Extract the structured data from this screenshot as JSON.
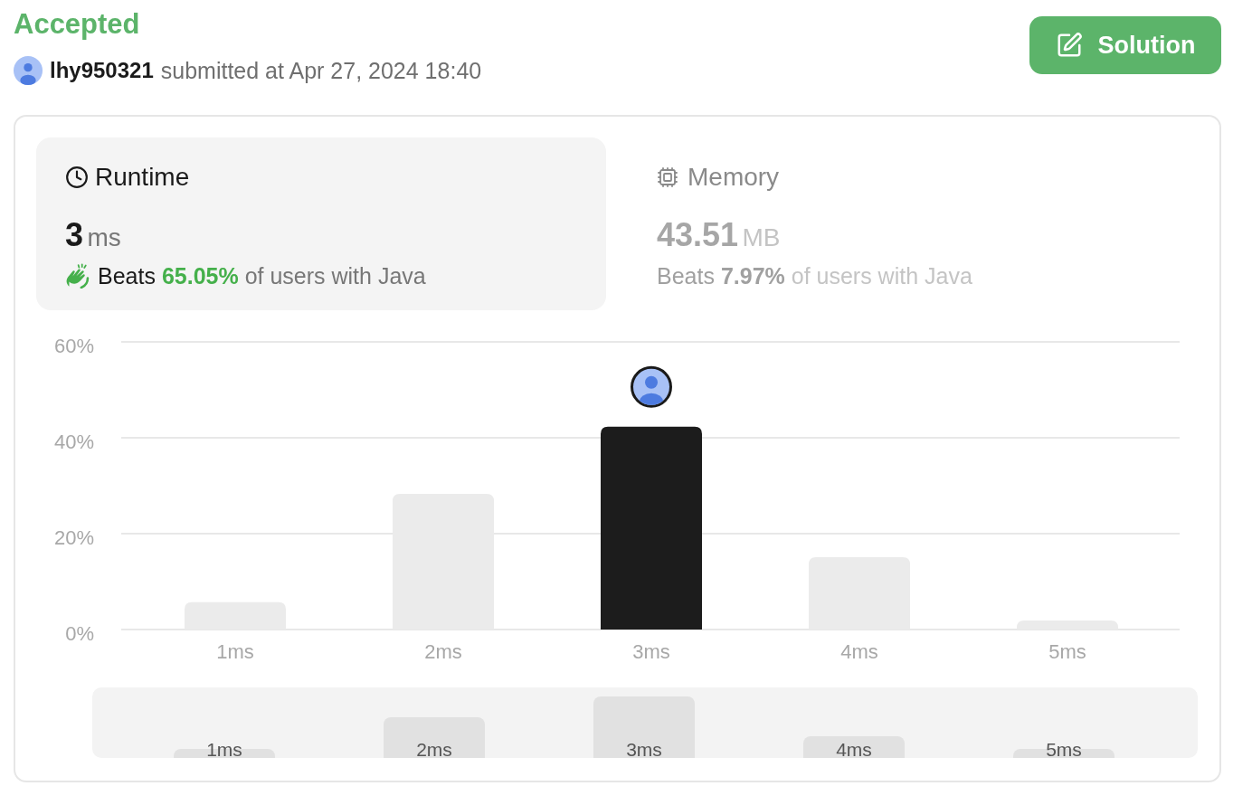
{
  "status": "Accepted",
  "submission": {
    "user": "lhy950321",
    "text": "submitted at Apr 27, 2024 18:40"
  },
  "solution_button": {
    "label": "Solution"
  },
  "stats": [
    {
      "kind": "runtime",
      "title": "Runtime",
      "value": "3",
      "unit": "ms",
      "beats_label": "Beats",
      "beats_value": "65.05%",
      "beats_suffix": "of users with Java",
      "selected": true
    },
    {
      "kind": "memory",
      "title": "Memory",
      "value": "43.51",
      "unit": "MB",
      "beats_label": "Beats",
      "beats_value": "7.97%",
      "beats_suffix": "of users with Java",
      "selected": false
    }
  ],
  "chart": {
    "chart_data": {
      "type": "bar",
      "categories": [
        "1ms",
        "2ms",
        "3ms",
        "4ms",
        "5ms"
      ],
      "values": [
        5.7,
        28.3,
        42.3,
        15.1,
        1.9
      ],
      "ylim": [
        0,
        60
      ],
      "yticks": [
        {
          "value": 0,
          "label": "0%"
        },
        {
          "value": 20,
          "label": "20%"
        },
        {
          "value": 40,
          "label": "40%"
        },
        {
          "value": 60,
          "label": "60%"
        }
      ]
    },
    "bar_states": [
      {
        "selected": false
      },
      {
        "selected": false
      },
      {
        "selected": true
      },
      {
        "selected": false
      },
      {
        "selected": false
      }
    ]
  },
  "overview": {
    "labels": [
      "1ms",
      "2ms",
      "3ms",
      "4ms",
      "5ms"
    ]
  }
}
